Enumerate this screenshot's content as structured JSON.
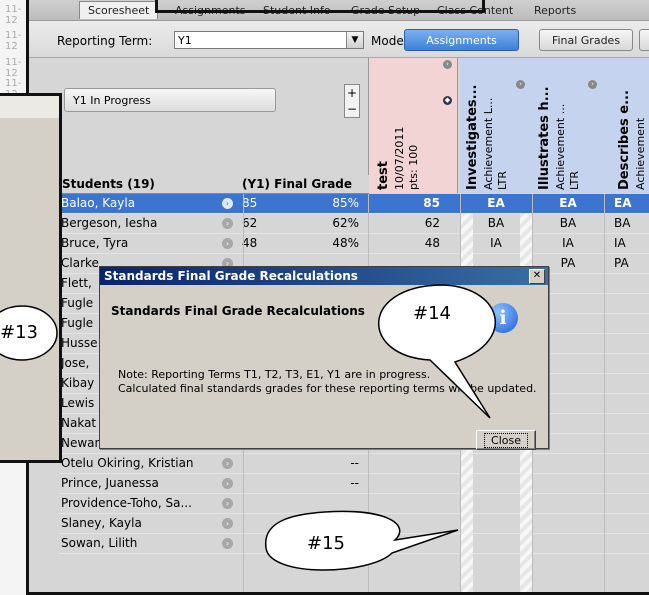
{
  "gutter_labels": [
    "11-12",
    "11-12",
    "11-12",
    "11-12"
  ],
  "tabs": [
    "Scoresheet",
    "Assignments",
    "Student Info",
    "Grade Setup",
    "Class Content",
    "Reports"
  ],
  "toolbar": {
    "reporting_term_label": "Reporting Term:",
    "reporting_term_value": "Y1",
    "mode_label": "Mode:",
    "mode_assignments": "Assignments",
    "mode_final_grades": "Final Grades"
  },
  "header": {
    "in_progress": "Y1 In Progress",
    "plus": "+",
    "minus": "−",
    "test_name": "test",
    "test_date": "10/07/2011",
    "test_pts": "pts: 100",
    "col1_title": "Investigates...",
    "col1_sub": "Achievement L...",
    "col1_ltr": "LTR",
    "col2_title": "Illustrates h...",
    "col2_sub": "Achievement ...",
    "col2_ltr": "LTR",
    "col3_title": "Describes e...",
    "col3_sub": "Achievement",
    "students_label": "Students (19)",
    "final_grade_label": "(Y1) Final Grade"
  },
  "students": [
    {
      "name": "Balao, Kayla",
      "fg": "85",
      "pct": "85%",
      "test": "85",
      "c1": "EA",
      "c2": "EA",
      "c3": "EA"
    },
    {
      "name": "Bergeson, Iesha",
      "fg": "62",
      "pct": "62%",
      "test": "62",
      "c1": "BA",
      "c2": "BA",
      "c3": "BA"
    },
    {
      "name": "Bruce, Tyra",
      "fg": "48",
      "pct": "48%",
      "test": "48",
      "c1": "IA",
      "c2": "IA",
      "c3": "IA"
    },
    {
      "name": "Clarke",
      "fg": "",
      "pct": "",
      "test": "",
      "c1": "",
      "c2": "PA",
      "c3": "PA"
    },
    {
      "name": "Flett,",
      "fg": "",
      "pct": "",
      "test": "",
      "c1": "",
      "c2": "",
      "c3": ""
    },
    {
      "name": "Fugle",
      "fg": "",
      "pct": "",
      "test": "",
      "c1": "",
      "c2": "",
      "c3": ""
    },
    {
      "name": "Fugle",
      "fg": "",
      "pct": "",
      "test": "",
      "c1": "",
      "c2": "",
      "c3": ""
    },
    {
      "name": "Husse",
      "fg": "",
      "pct": "",
      "test": "",
      "c1": "",
      "c2": "",
      "c3": ""
    },
    {
      "name": "Jose,",
      "fg": "",
      "pct": "",
      "test": "",
      "c1": "",
      "c2": "",
      "c3": ""
    },
    {
      "name": "Kibay",
      "fg": "",
      "pct": "",
      "test": "",
      "c1": "",
      "c2": "",
      "c3": ""
    },
    {
      "name": "Lewis",
      "fg": "",
      "pct": "",
      "test": "",
      "c1": "",
      "c2": "",
      "c3": ""
    },
    {
      "name": "Nakat",
      "fg": "",
      "pct": "",
      "test": "",
      "c1": "",
      "c2": "",
      "c3": ""
    },
    {
      "name": "Newans, James Dale",
      "fg": "",
      "pct": "",
      "test": "",
      "c1": "",
      "c2": "",
      "c3": ""
    },
    {
      "name": "Otelu Okiring, Kristian",
      "fg": "",
      "pct": "--",
      "test": "",
      "c1": "",
      "c2": "",
      "c3": ""
    },
    {
      "name": "Prince, Juanessa",
      "fg": "",
      "pct": "--",
      "test": "",
      "c1": "",
      "c2": "",
      "c3": ""
    },
    {
      "name": "Providence-Toho, Sa...",
      "fg": "",
      "pct": "",
      "test": "",
      "c1": "",
      "c2": "",
      "c3": ""
    },
    {
      "name": "Slaney, Kayla",
      "fg": "",
      "pct": "",
      "test": "",
      "c1": "",
      "c2": "",
      "c3": ""
    },
    {
      "name": "Sowan, Lilith",
      "fg": "",
      "pct": "",
      "test": "",
      "c1": "",
      "c2": "",
      "c3": ""
    }
  ],
  "dialog": {
    "title": "Standards Final Grade Recalculations",
    "heading": "Standards Final Grade Recalculations",
    "note_line1": "Note: Reporting Terms T1, T2, T3, E1, Y1 are in progress.",
    "note_line2": "Calculated final standards grades for these reporting terms will be updated.",
    "close_button": "Close",
    "close_x": "✕"
  },
  "callouts": {
    "c13": "#13",
    "c14": "#14",
    "c15": "#15"
  },
  "colors": {
    "selected_row": "#3d74d0",
    "test_column": "#f3d4d4",
    "standards_column": "#c6d3ef",
    "dialog_title": "#0a246a",
    "mode_active": "#3f7fd8"
  }
}
